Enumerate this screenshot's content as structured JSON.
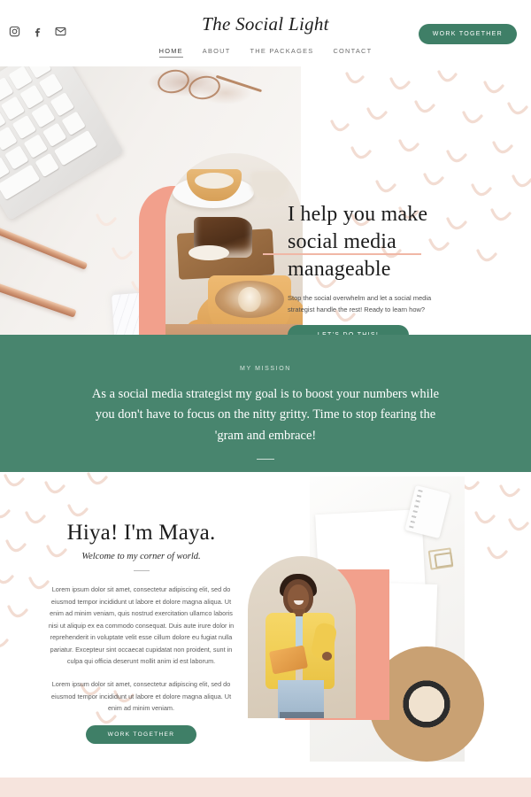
{
  "site": {
    "logo": "The Social Light",
    "accent_green": "#3f7f67",
    "mission_green": "#48856e",
    "salmon": "#f2a08c",
    "blush": "#f6e4dd"
  },
  "header": {
    "social": [
      {
        "name": "instagram-icon",
        "label": "Instagram"
      },
      {
        "name": "facebook-icon",
        "label": "Facebook"
      },
      {
        "name": "email-icon",
        "label": "Email"
      }
    ],
    "nav": [
      {
        "label": "HOME",
        "active": true
      },
      {
        "label": "ABOUT",
        "active": false
      },
      {
        "label": "THE PACKAGES",
        "active": false
      },
      {
        "label": "CONTACT",
        "active": false
      }
    ],
    "cta": "WORK TOGETHER"
  },
  "hero": {
    "heading_line1": "I help you make",
    "heading_line2": "social media",
    "heading_line3": "manageable",
    "paragraph": "Stop the social overwhelm and let a social media strategist handle the rest! Ready to learn how?",
    "cta": "LET'S DO THIS!"
  },
  "mission": {
    "eyebrow": "MY MISSION",
    "text": "As a social media strategist my goal is to boost your numbers while you don't have to focus on the nitty gritty. Time to stop fearing the 'gram and embrace!"
  },
  "about": {
    "heading": "Hiya! I'm Maya.",
    "subheading": "Welcome to my corner of world.",
    "paragraph1": "Lorem ipsum dolor sit amet, consectetur adipiscing elit, sed do eiusmod tempor incididunt ut labore et dolore magna aliqua. Ut enim ad minim veniam, quis nostrud exercitation ullamco laboris nisi ut aliquip ex ea commodo consequat. Duis aute irure dolor in reprehenderit in voluptate velit esse cillum dolore eu fugiat nulla pariatur. Excepteur sint occaecat cupidatat non proident, sunt in culpa qui officia deserunt mollit anim id est laborum.",
    "paragraph2": "Lorem ipsum dolor sit amet, consectetur adipiscing elit, sed do eiusmod tempor incididunt ut labore et dolore magna aliqua. Ut enim ad minim veniam.",
    "cta": "WORK TOGETHER"
  }
}
